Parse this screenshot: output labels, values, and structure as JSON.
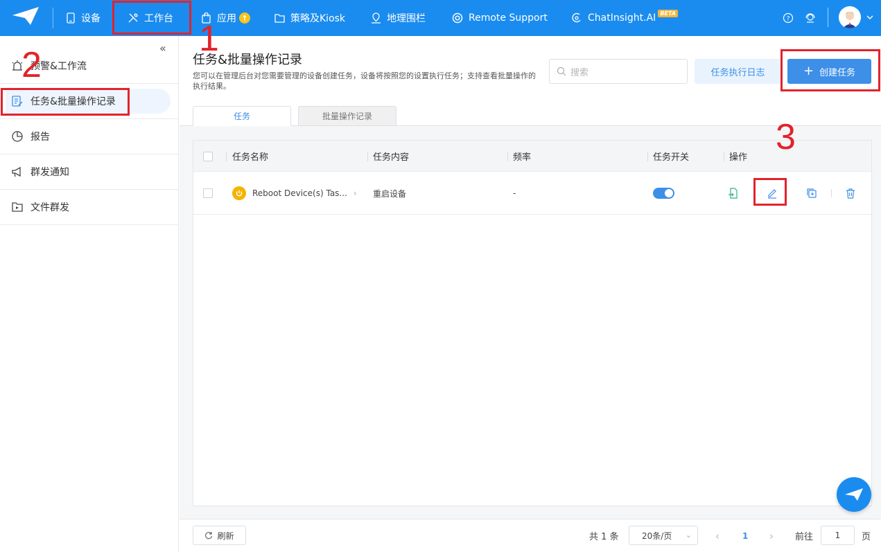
{
  "nav": {
    "items": [
      {
        "label": "设备"
      },
      {
        "label": "工作台"
      },
      {
        "label": "应用"
      },
      {
        "label": "策略及Kiosk"
      },
      {
        "label": "地理围栏"
      },
      {
        "label": "Remote Support"
      },
      {
        "label": "ChatInsight.AI",
        "badge": "BETA"
      }
    ]
  },
  "sidebar": {
    "items": [
      {
        "label": "预警&工作流",
        "icon": "alarm-icon"
      },
      {
        "label": "任务&批量操作记录",
        "icon": "task-edit-icon"
      },
      {
        "label": "报告",
        "icon": "pie-chart-icon"
      },
      {
        "label": "群发通知",
        "icon": "megaphone-icon"
      },
      {
        "label": "文件群发",
        "icon": "file-send-icon"
      }
    ]
  },
  "main": {
    "title": "任务&批量操作记录",
    "description": "您可以在管理后台对您需要管理的设备创建任务，设备将按照您的设置执行任务；支持查看批量操作的执行结果。",
    "search_placeholder": "搜索",
    "log_button": "任务执行日志",
    "create_button": "创建任务",
    "tabs": [
      {
        "label": "任务"
      },
      {
        "label": "批量操作记录"
      }
    ]
  },
  "table": {
    "columns": [
      "任务名称",
      "任务内容",
      "频率",
      "任务开关",
      "操作"
    ],
    "rows": [
      {
        "name": "Reboot Device(s) Tas...",
        "content": "重启设备",
        "frequency": "-",
        "enabled": true
      }
    ]
  },
  "footer": {
    "refresh": "刷新",
    "total": "共 1 条",
    "page_size": "20条/页",
    "current_page": "1",
    "goto_label": "前往",
    "goto_value": "1",
    "page_unit": "页"
  },
  "annotations": [
    "1",
    "2",
    "3"
  ],
  "colors": {
    "primary": "#1a8cf0",
    "accent": "#3d8fe8",
    "annotation": "#e3222a"
  }
}
